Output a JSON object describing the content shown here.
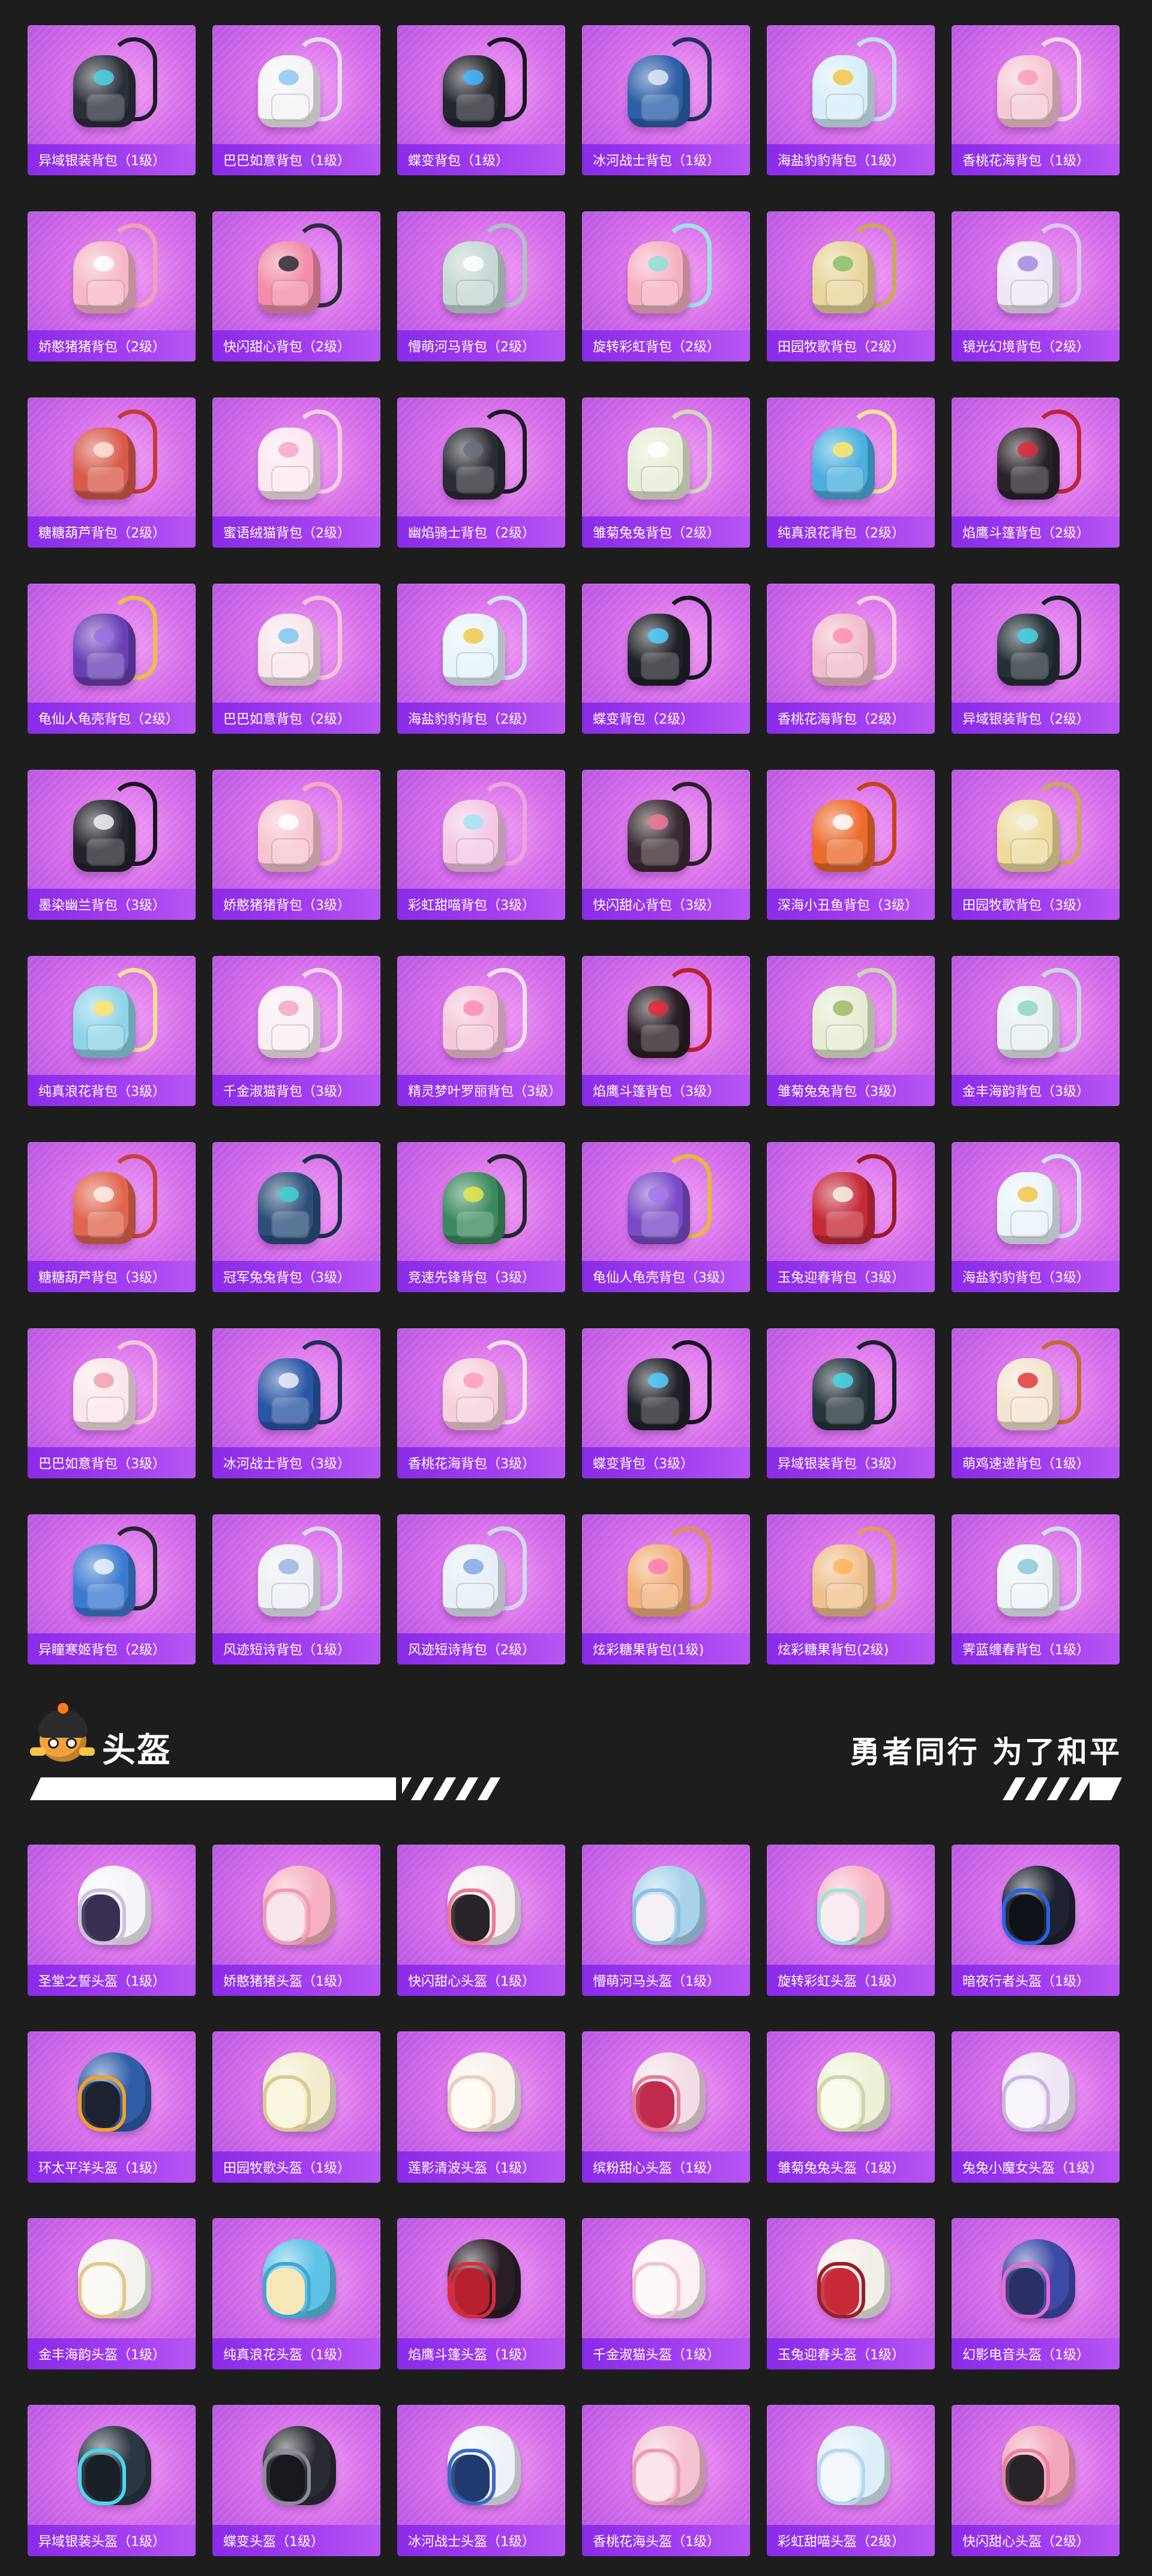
{
  "colors": {
    "background": "#1d1d1d",
    "card": "#d56cea",
    "label_bar": "#8a2be8",
    "text": "#ffffff"
  },
  "backpacks": [
    {
      "label": "异域银装背包（1级）",
      "icon": "backpack-icon",
      "bag": "#2b2f3a",
      "strap": "#1b1e28",
      "accent": "#4ad2e8"
    },
    {
      "label": "巴巴如意背包（1级）",
      "icon": "backpack-icon",
      "bag": "#f5f3f7",
      "strap": "#e6e0ee",
      "accent": "#8fc8f0"
    },
    {
      "label": "蝶变背包（1级）",
      "icon": "backpack-icon",
      "bag": "#24262e",
      "strap": "#15171e",
      "accent": "#3fb6ff"
    },
    {
      "label": "冰河战士背包（1级）",
      "icon": "backpack-icon",
      "bag": "#2c5fa8",
      "strap": "#21325a",
      "accent": "#dfe8f6"
    },
    {
      "label": "海盐豹豹背包（1级）",
      "icon": "backpack-icon",
      "bag": "#d7eefa",
      "strap": "#c6e0ee",
      "accent": "#f0c84a"
    },
    {
      "label": "香桃花海背包（1级）",
      "icon": "backpack-icon",
      "bag": "#f6c8d4",
      "strap": "#f3dbe2",
      "accent": "#ff9cb6"
    },
    {
      "label": "娇憨猪猪背包（2级）",
      "icon": "backpack-icon",
      "bag": "#f6b8c6",
      "strap": "#f0a2b6",
      "accent": "#ffffff"
    },
    {
      "label": "快闪甜心背包（2级）",
      "icon": "backpack-icon",
      "bag": "#f28ca8",
      "strap": "#2d2d35",
      "accent": "#2d2d35"
    },
    {
      "label": "懵萌河马背包（2级）",
      "icon": "backpack-icon",
      "bag": "#c5d7d4",
      "strap": "#aec3c0",
      "accent": "#ffffff"
    },
    {
      "label": "旋转彩虹背包（2级）",
      "icon": "backpack-icon",
      "bag": "#f6b0c2",
      "strap": "#9fe3e0",
      "accent": "#8ce0d8"
    },
    {
      "label": "田园牧歌背包（2级）",
      "icon": "backpack-icon",
      "bag": "#e8d59a",
      "strap": "#c9a85a",
      "accent": "#8abf6a"
    },
    {
      "label": "镜光幻境背包（2级）",
      "icon": "backpack-icon",
      "bag": "#efe6f6",
      "strap": "#d9c8ec",
      "accent": "#a488e0"
    },
    {
      "label": "糖糖葫芦背包（2级）",
      "icon": "backpack-icon",
      "bag": "#d95a4a",
      "strap": "#c43a34",
      "accent": "#ffe2d8"
    },
    {
      "label": "蜜语绒猫背包（2级）",
      "icon": "backpack-icon",
      "bag": "#fbe8f0",
      "strap": "#f3cfe0",
      "accent": "#f6a8c8"
    },
    {
      "label": "幽焰骑士背包（2级）",
      "icon": "backpack-icon",
      "bag": "#2a2c33",
      "strap": "#191a20",
      "accent": "#6a6f7e"
    },
    {
      "label": "雏菊兔兔背包（2级）",
      "icon": "backpack-icon",
      "bag": "#e7eed6",
      "strap": "#cfd9b8",
      "accent": "#ffffff"
    },
    {
      "label": "纯真浪花背包（2级）",
      "icon": "backpack-icon",
      "bag": "#4ab0e0",
      "strap": "#f4e29a",
      "accent": "#ffe56a"
    },
    {
      "label": "焰鹰斗篷背包（2级）",
      "icon": "backpack-icon",
      "bag": "#2a2229",
      "strap": "#c02438",
      "accent": "#e0283e"
    },
    {
      "label": "龟仙人龟壳背包（2级）",
      "icon": "backpack-icon",
      "bag": "#6a3fb6",
      "strap": "#e8c04a",
      "accent": "#9d6ee6"
    },
    {
      "label": "巴巴如意背包（2级）",
      "icon": "backpack-icon",
      "bag": "#f8e6ec",
      "strap": "#f2c6d6",
      "accent": "#7fc6f0"
    },
    {
      "label": "海盐豹豹背包（2级）",
      "icon": "backpack-icon",
      "bag": "#e6f4fb",
      "strap": "#cfe6f2",
      "accent": "#f0c84a"
    },
    {
      "label": "蝶变背包（2级）",
      "icon": "backpack-icon",
      "bag": "#1f2128",
      "strap": "#15171e",
      "accent": "#4fd0ff"
    },
    {
      "label": "香桃花海背包（2级）",
      "icon": "backpack-icon",
      "bag": "#f2bccc",
      "strap": "#f0d2dc",
      "accent": "#ff8fae"
    },
    {
      "label": "异域银装背包（2级）",
      "icon": "backpack-icon",
      "bag": "#243038",
      "strap": "#1a1f26",
      "accent": "#44d4e8"
    },
    {
      "label": "墨染幽兰背包（3级）",
      "icon": "backpack-icon",
      "bag": "#22232a",
      "strap": "#15161c",
      "accent": "#f2f0f4"
    },
    {
      "label": "娇憨猪猪背包（3级）",
      "icon": "backpack-icon",
      "bag": "#f8c4d0",
      "strap": "#f2aebf",
      "accent": "#ffffff"
    },
    {
      "label": "彩虹甜喵背包（3级）",
      "icon": "backpack-icon",
      "bag": "#f4c7e6",
      "strap": "#eaa6da",
      "accent": "#a3e4f2"
    },
    {
      "label": "快闪甜心背包（3级）",
      "icon": "backpack-icon",
      "bag": "#3a2a33",
      "strap": "#2a1f26",
      "accent": "#f07896"
    },
    {
      "label": "深海小丑鱼背包（3级）",
      "icon": "backpack-icon",
      "bag": "#ee6a2a",
      "strap": "#c7421a",
      "accent": "#ffffff"
    },
    {
      "label": "田园牧歌背包（3级）",
      "icon": "backpack-icon",
      "bag": "#eedb9c",
      "strap": "#c9a85a",
      "accent": "#f6f0e0"
    },
    {
      "label": "纯真浪花背包（3级）",
      "icon": "backpack-icon",
      "bag": "#8fd4e8",
      "strap": "#f3df98",
      "accent": "#ffe46a"
    },
    {
      "label": "千金淑猫背包（3级）",
      "icon": "backpack-icon",
      "bag": "#fbeef4",
      "strap": "#f3d6e4",
      "accent": "#f6a6c6"
    },
    {
      "label": "精灵梦叶罗丽背包（3级）",
      "icon": "backpack-icon",
      "bag": "#f6c6da",
      "strap": "#f0e2ec",
      "accent": "#ff8ab6"
    },
    {
      "label": "焰鹰斗篷背包（3级）",
      "icon": "backpack-icon",
      "bag": "#2a1e26",
      "strap": "#b8202e",
      "accent": "#e6283c"
    },
    {
      "label": "雏菊兔兔背包（3级）",
      "icon": "backpack-icon",
      "bag": "#e6ecd2",
      "strap": "#cbd6b4",
      "accent": "#9fb86a"
    },
    {
      "label": "金丰海韵背包（3级）",
      "icon": "backpack-icon",
      "bag": "#e8f0f2",
      "strap": "#cad8dc",
      "accent": "#8fd6c8"
    },
    {
      "label": "糖糖葫芦背包（3级）",
      "icon": "backpack-icon",
      "bag": "#e0664e",
      "strap": "#c4423a",
      "accent": "#fff0e6"
    },
    {
      "label": "冠军兔兔背包（3级）",
      "icon": "backpack-icon",
      "bag": "#2b4f7a",
      "strap": "#1c2f4a",
      "accent": "#3fd2d2"
    },
    {
      "label": "竞速先锋背包（3级）",
      "icon": "backpack-icon",
      "bag": "#3a8a5e",
      "strap": "#24262c",
      "accent": "#e6e84a"
    },
    {
      "label": "龟仙人龟壳背包（3级）",
      "icon": "backpack-icon",
      "bag": "#7a4ac8",
      "strap": "#e6b840",
      "accent": "#a678ee"
    },
    {
      "label": "玉兔迎春背包（3级）",
      "icon": "backpack-icon",
      "bag": "#c62a38",
      "strap": "#9a1c28",
      "accent": "#f6f2e8"
    },
    {
      "label": "海盐豹豹背包（3级）",
      "icon": "backpack-icon",
      "bag": "#e9f4fa",
      "strap": "#cfe4f0",
      "accent": "#f2c64a"
    },
    {
      "label": "巴巴如意背包（3级）",
      "icon": "backpack-icon",
      "bag": "#fae6ea",
      "strap": "#f2c8d2",
      "accent": "#f0a0b0"
    },
    {
      "label": "冰河战士背包（3级）",
      "icon": "backpack-icon",
      "bag": "#2a56a4",
      "strap": "#1f2f56",
      "accent": "#e8eef8"
    },
    {
      "label": "香桃花海背包（3级）",
      "icon": "backpack-icon",
      "bag": "#f6d0da",
      "strap": "#f2e0e6",
      "accent": "#ff9cb8"
    },
    {
      "label": "蝶变背包（3级）",
      "icon": "backpack-icon",
      "bag": "#202229",
      "strap": "#14161c",
      "accent": "#4ecfff"
    },
    {
      "label": "异域银装背包（3级）",
      "icon": "backpack-icon",
      "bag": "#26343c",
      "strap": "#1a2028",
      "accent": "#46d6ea"
    },
    {
      "label": "萌鸡速递背包（1级）",
      "icon": "backpack-icon",
      "bag": "#f4e4ce",
      "strap": "#c46a3a",
      "accent": "#e23a3a"
    },
    {
      "label": "异瞳寒姬背包（2级）",
      "icon": "backpack-icon",
      "bag": "#3a7ad0",
      "strap": "#24262e",
      "accent": "#eaf2fa"
    },
    {
      "label": "风迹短诗背包（1级）",
      "icon": "backpack-icon",
      "bag": "#eef0f6",
      "strap": "#d8dcea",
      "accent": "#9cb4e0"
    },
    {
      "label": "风迹短诗背包（2级）",
      "icon": "backpack-icon",
      "bag": "#e6eef8",
      "strap": "#d0daea",
      "accent": "#86a8e0"
    },
    {
      "label": "炫彩糖果背包(1级)",
      "icon": "backpack-icon",
      "bag": "#f2b07a",
      "strap": "#e0905a",
      "accent": "#ff7ab0"
    },
    {
      "label": "炫彩糖果背包(2级)",
      "icon": "backpack-icon",
      "bag": "#f0c08e",
      "strap": "#e09a62",
      "accent": "#ffb45a"
    },
    {
      "label": "霁蓝缠春背包（1级）",
      "icon": "backpack-icon",
      "bag": "#eef4f6",
      "strap": "#d4e0e6",
      "accent": "#8cc8d8"
    }
  ],
  "section": {
    "title": "头盔",
    "slogan": "勇者同行 为了和平",
    "mascot_icon": "mascot-helmet-icon"
  },
  "helmets": [
    {
      "label": "圣堂之誓头盔（1级）",
      "icon": "helmet-icon",
      "shell": "#f6f4fa",
      "inner": "#3a2e52",
      "rim": "#cbc3dc"
    },
    {
      "label": "娇憨猪猪头盔（1级）",
      "icon": "helmet-icon",
      "shell": "#f6b2c2",
      "inner": "#f6e6ee",
      "rim": "#ee9cb2"
    },
    {
      "label": "快闪甜心头盔（1级）",
      "icon": "helmet-icon",
      "shell": "#f4eef2",
      "inner": "#2a2229",
      "rim": "#f07896"
    },
    {
      "label": "懵萌河马头盔（1级）",
      "icon": "helmet-icon",
      "shell": "#a9d2ec",
      "inner": "#f4f0f6",
      "rim": "#8ec0e2"
    },
    {
      "label": "旋转彩虹头盔（1级）",
      "icon": "helmet-icon",
      "shell": "#f6b6c6",
      "inner": "#f8ecf2",
      "rim": "#9ee2dc"
    },
    {
      "label": "暗夜行者头盔（1级）",
      "icon": "helmet-icon",
      "shell": "#1f2230",
      "inner": "#0f1118",
      "rim": "#2a62e8"
    },
    {
      "label": "环太平洋头盔（1级）",
      "icon": "helmet-icon",
      "shell": "#2e5ea8",
      "inner": "#1c2230",
      "rim": "#f0a02a"
    },
    {
      "label": "田园牧歌头盔（1级）",
      "icon": "helmet-icon",
      "shell": "#f2eccc",
      "inner": "#fbf6e0",
      "rim": "#d8cb92"
    },
    {
      "label": "莲影清波头盔（1级）",
      "icon": "helmet-icon",
      "shell": "#f8f0ea",
      "inner": "#fffaf4",
      "rim": "#e8cfc0"
    },
    {
      "label": "缤粉甜心头盔（1级）",
      "icon": "helmet-icon",
      "shell": "#f3dce6",
      "inner": "#c02a4e",
      "rim": "#e47c9a"
    },
    {
      "label": "雏菊兔兔头盔（1级）",
      "icon": "helmet-icon",
      "shell": "#eef0d8",
      "inner": "#fafbee",
      "rim": "#cfd6a8"
    },
    {
      "label": "兔兔小魔女头盔（1级）",
      "icon": "helmet-icon",
      "shell": "#eee6f4",
      "inner": "#f8f4fb",
      "rim": "#c9b6e0"
    },
    {
      "label": "金丰海韵头盔（1级）",
      "icon": "helmet-icon",
      "shell": "#f4f2ee",
      "inner": "#fbf9f4",
      "rim": "#e2c88a"
    },
    {
      "label": "纯真浪花头盔（1级）",
      "icon": "helmet-icon",
      "shell": "#5cc2e6",
      "inner": "#f6e8b8",
      "rim": "#3ea6d2"
    },
    {
      "label": "焰鹰斗篷头盔（1级）",
      "icon": "helmet-icon",
      "shell": "#2a1e26",
      "inner": "#b8202e",
      "rim": "#e0283c"
    },
    {
      "label": "千金淑猫头盔（1级）",
      "icon": "helmet-icon",
      "shell": "#fbf0f4",
      "inner": "#fdf8fa",
      "rim": "#f2c2d6"
    },
    {
      "label": "玉兔迎春头盔（1级）",
      "icon": "helmet-icon",
      "shell": "#f2eee8",
      "inner": "#c62a38",
      "rim": "#9a1c28"
    },
    {
      "label": "幻影电音头盔（1级）",
      "icon": "helmet-icon",
      "shell": "#3e4aa8",
      "inner": "#2a2f6a",
      "rim": "#e86ad2"
    },
    {
      "label": "异域银装头盔（1级）",
      "icon": "helmet-icon",
      "shell": "#2a3640",
      "inner": "#1a2028",
      "rim": "#48d8ec"
    },
    {
      "label": "蝶变头盔（1级）",
      "icon": "helmet-icon",
      "shell": "#2a2c33",
      "inner": "#16181e",
      "rim": "#8a8e9a"
    },
    {
      "label": "冰河战士头盔（1级）",
      "icon": "helmet-icon",
      "shell": "#eef2f8",
      "inner": "#1f3a6e",
      "rim": "#3a6ac8"
    },
    {
      "label": "香桃花海头盔（1级）",
      "icon": "helmet-icon",
      "shell": "#f4c2d0",
      "inner": "#fbe4ec",
      "rim": "#ee9cb6"
    },
    {
      "label": "彩虹甜喵头盔（2级）",
      "icon": "helmet-icon",
      "shell": "#dceef8",
      "inner": "#f4f8fc",
      "rim": "#b6d8ee"
    },
    {
      "label": "快闪甜心头盔（2级）",
      "icon": "helmet-icon",
      "shell": "#f2a6ba",
      "inner": "#2a2229",
      "rim": "#e8829e"
    }
  ]
}
